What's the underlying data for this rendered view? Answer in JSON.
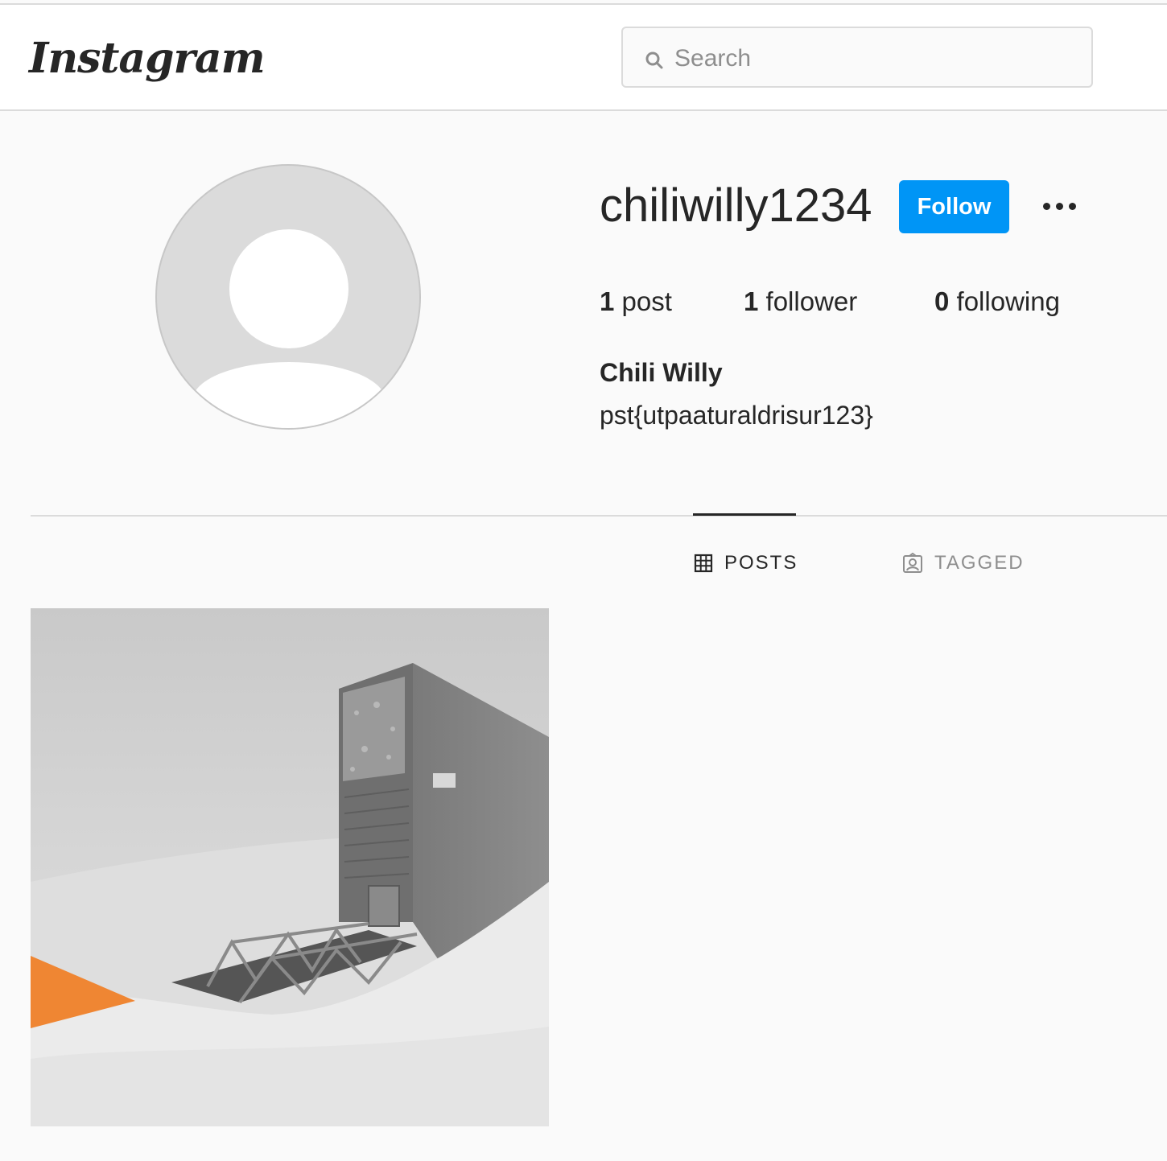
{
  "header": {
    "logo_text": "Instagram",
    "search": {
      "placeholder": "Search",
      "value": ""
    }
  },
  "profile": {
    "username": "chiliwilly1234",
    "follow_label": "Follow",
    "stats": [
      {
        "count": "1",
        "label": "post"
      },
      {
        "count": "1",
        "label": "follower"
      },
      {
        "count": "0",
        "label": "following"
      }
    ],
    "full_name": "Chili Willy",
    "bio": "pst{utpaaturaldrisur123}"
  },
  "tabs": [
    {
      "label": "POSTS",
      "icon": "grid-icon",
      "active": true
    },
    {
      "label": "TAGGED",
      "icon": "tagged-icon",
      "active": false
    }
  ],
  "posts": [
    {
      "description": "grayscale photo of a vault building in the snow with a footbridge and an orange wedge"
    }
  ],
  "colors": {
    "accent": "#0095f6",
    "text": "#262626",
    "muted": "#8e8e8e",
    "border": "#dbdbdb",
    "highlight": "#ef8633"
  }
}
